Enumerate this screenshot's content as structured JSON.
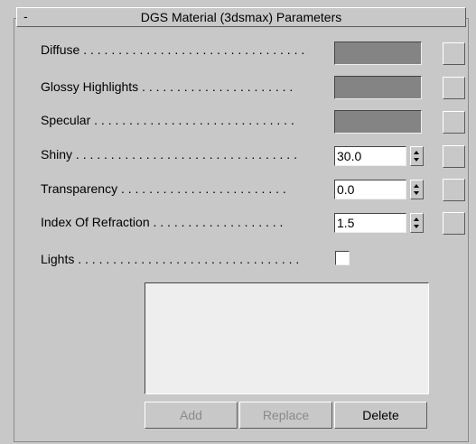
{
  "rollout": {
    "collapse_symbol": "-",
    "title": "DGS Material (3dsmax) Parameters"
  },
  "params": {
    "diffuse": "Diffuse . . . . . . . . . . . . . . . . . . . . . . . . . . . . . . . .",
    "glossy": "Glossy Highlights . . . . . . . . . . . . . . . . . . . . . .",
    "specular": "Specular . . . . . . . . . . . . . . . . . . . . . . . . . . . . .",
    "shiny": "Shiny . . . . . . . . . . . . . . . . . . . . . . . . . . . . . . . .",
    "transparency": "Transparency . . . . . . . . . . . . . . . . . . . . . . . .",
    "ior": "Index Of Refraction . . . . . . . . . . . . . . . . . . .",
    "lights": "Lights . . . . . . . . . . . . . . . . . . . . . . . . . . . . . . . ."
  },
  "values": {
    "shiny": "30.0",
    "transparency": "0.0",
    "ior": "1.5",
    "lights_checked": false
  },
  "colors": {
    "diffuse_swatch": "#848484",
    "glossy_swatch": "#848484",
    "specular_swatch": "#848484"
  },
  "lights_list": {
    "items": []
  },
  "buttons": {
    "add": "Add",
    "replace": "Replace",
    "delete": "Delete"
  }
}
